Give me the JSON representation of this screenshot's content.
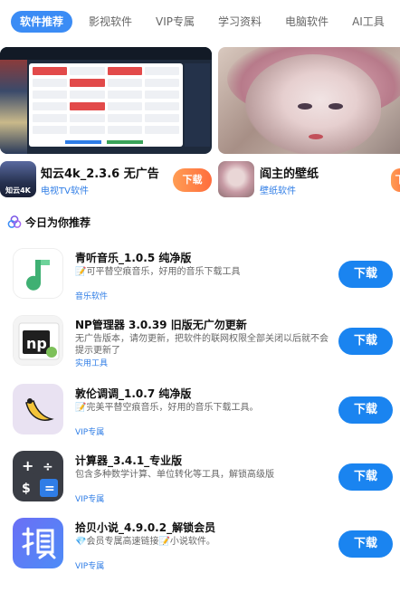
{
  "tabs": [
    "软件推荐",
    "影视软件",
    "VIP专属",
    "学习资料",
    "电脑软件",
    "AI工具"
  ],
  "active_tab": 0,
  "banner_strip": [
    {
      "title": "知云4k_2.3.6 无广告",
      "category": "电视TV软件",
      "icon_caption": "知云4K",
      "download": "下载"
    },
    {
      "title": "阎主的壁纸",
      "category": "壁纸软件",
      "download": "下"
    }
  ],
  "section": {
    "title": "今日为你推荐"
  },
  "apps": [
    {
      "title": "青听音乐_1.0.5 纯净版",
      "desc": "📝可平替空痕音乐，好用的音乐下载工具",
      "category": "音乐软件",
      "icon": "music-note-icon",
      "download": "下载"
    },
    {
      "title": "NP管理器 3.0.39 旧版无广勿更新",
      "desc": "无广告版本，请勿更新，把软件的联网权限全部关闭以后就不会提示更新了",
      "category": "实用工具",
      "icon": "np-manager-icon",
      "download": "下载"
    },
    {
      "title": "敦伦调调_1.0.7 纯净版",
      "desc": "📝完美平替空痕音乐，好用的音乐下载工具。",
      "category": "VIP专属",
      "icon": "banana-icon",
      "download": "下载"
    },
    {
      "title": "计算器_3.4.1_专业版",
      "desc": "包含多种数学计算、单位转化等工具，解锁高级版",
      "category": "VIP专属",
      "icon": "calculator-icon",
      "download": "下载"
    },
    {
      "title": "拾贝小说_4.9.0.2_解锁会员",
      "desc": "💎会员专属高速链接📝小说软件。",
      "category": "VIP专属",
      "icon": "shibei-icon",
      "download": "下载"
    }
  ]
}
